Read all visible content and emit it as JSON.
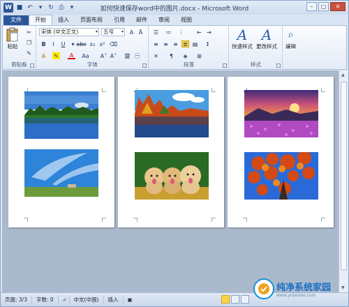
{
  "window": {
    "title": "如何快速保存word中的图片.docx - Microsoft Word",
    "app_letter": "W"
  },
  "tabs": [
    "文件",
    "开始",
    "插入",
    "页面布局",
    "引用",
    "邮件",
    "审阅",
    "视图"
  ],
  "ribbon": {
    "clipboard": {
      "label": "剪贴板",
      "paste": "粘贴"
    },
    "font": {
      "label": "字体",
      "name": "宋体 (中文正文)",
      "size": "五号"
    },
    "paragraph": {
      "label": "段落"
    },
    "styles": {
      "label": "样式",
      "quick": "快速样式",
      "change": "更改样式"
    },
    "editing": {
      "label": "编辑"
    }
  },
  "status": {
    "page": "页面: 3/3",
    "words": "字数: 0",
    "lang": "中文(中国)",
    "mode": "插入"
  },
  "watermark": {
    "brand": "纯净系统家园",
    "url": "www.yidaimei.com"
  },
  "pages": [
    {
      "images": [
        "lake-forest-reflection",
        "blue-sky-clouds-field"
      ]
    },
    {
      "images": [
        "autumn-lake-reflection",
        "three-golden-retriever-puppies"
      ]
    },
    {
      "images": [
        "sunset-purple-flower-field",
        "red-autumn-leaves-blue-sky"
      ]
    }
  ]
}
